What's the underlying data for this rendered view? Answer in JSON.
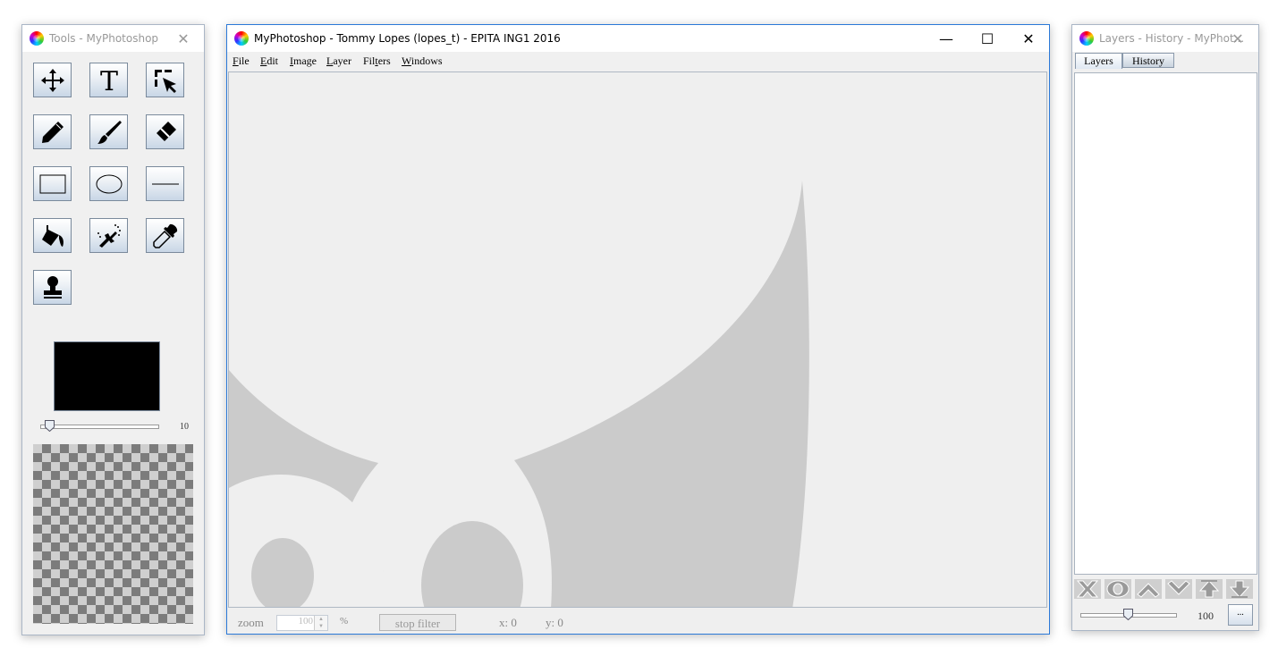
{
  "tools_window": {
    "title": "Tools - MyPhotoshop",
    "close_glyph": "✕",
    "tools": [
      {
        "name": "move-tool",
        "icon": "move-icon"
      },
      {
        "name": "text-tool",
        "icon": "text-icon"
      },
      {
        "name": "selection-tool",
        "icon": "selection-icon"
      },
      {
        "name": "pencil-tool",
        "icon": "pencil-icon"
      },
      {
        "name": "brush-tool",
        "icon": "brush-icon"
      },
      {
        "name": "eraser-tool",
        "icon": "eraser-icon"
      },
      {
        "name": "rectangle-tool",
        "icon": "rectangle-icon"
      },
      {
        "name": "ellipse-tool",
        "icon": "ellipse-icon"
      },
      {
        "name": "line-tool",
        "icon": "line-icon"
      },
      {
        "name": "fill-tool",
        "icon": "paint-bucket-icon"
      },
      {
        "name": "spray-tool",
        "icon": "spray-icon"
      },
      {
        "name": "eyedropper-tool",
        "icon": "eyedropper-icon"
      },
      {
        "name": "stamp-tool",
        "icon": "stamp-icon"
      }
    ],
    "current_color": "#000000",
    "brush_size": "10"
  },
  "main_window": {
    "title": "MyPhotoshop - Tommy Lopes (lopes_t) - EPITA ING1 2016",
    "minimize_glyph": "—",
    "maximize_glyph": "☐",
    "close_glyph": "✕",
    "menu": {
      "file": {
        "mnemonic": "F",
        "rest": "ile"
      },
      "edit": {
        "mnemonic": "E",
        "rest": "dit"
      },
      "image": {
        "mnemonic": "I",
        "rest": "mage"
      },
      "layer": {
        "mnemonic": "L",
        "rest": "ayer"
      },
      "filters_pre": "Fil",
      "filters_mnemonic": "t",
      "filters_post": "ers",
      "windows": {
        "mnemonic": "W",
        "rest": "indows"
      }
    },
    "status": {
      "zoom_label": "zoom",
      "zoom_value": "100",
      "percent_label": "%",
      "stop_filter_label": "stop filter",
      "x_label": "x: 0",
      "y_label": "y: 0"
    }
  },
  "layers_window": {
    "title": "Layers - History - MyPhot...",
    "close_glyph": "✕",
    "tabs": [
      "Layers",
      "History"
    ],
    "active_tab": "Layers",
    "buttons": [
      "delete-layer-icon",
      "toggle-visibility-icon",
      "move-up-icon",
      "move-down-icon",
      "move-top-icon",
      "move-bottom-icon"
    ],
    "opacity_value": "100",
    "more_label": "..."
  }
}
